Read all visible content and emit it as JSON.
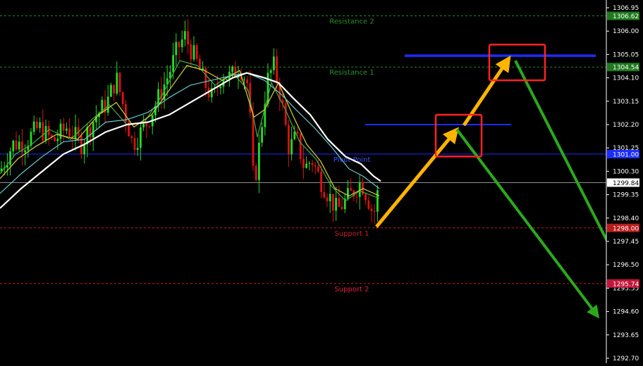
{
  "chart_data": {
    "type": "candlestick",
    "ylim": [
      1292.7,
      1306.95
    ],
    "y_ticks": [
      "1306.95",
      "1306.00",
      "1305.05",
      "1304.10",
      "1303.15",
      "1302.20",
      "1301.25",
      "1300.30",
      "1299.35",
      "1298.40",
      "1297.45",
      "1296.50",
      "1295.55",
      "1294.60",
      "1293.65",
      "1292.70"
    ],
    "current_price": "1299.84",
    "colors": {
      "background": "#000000",
      "bull": "#22dd22",
      "bear": "#dd1111",
      "ma_white": "#ffffff",
      "ma_cyan": "#66cccc",
      "ma_yellow": "#d6d63a",
      "ma_green": "#44aa44",
      "pivot": "#1a2cff",
      "resistance": "#238a23",
      "support": "#c81e1e",
      "arrow_up": "#ffb400",
      "arrow_down": "#2aaa1a",
      "box": "#ff2222"
    },
    "levels": [
      {
        "name": "Resistance 2",
        "value": 1306.62,
        "value_label": "1306.62",
        "style": "dash",
        "color": "#238a23",
        "label_color": "#2a8f2a",
        "tag_bg": "#1f7a1f"
      },
      {
        "name": "Resistance 1",
        "value": 1304.54,
        "value_label": "1304.54",
        "style": "dash",
        "color": "#238a23",
        "label_color": "#2a8f2a",
        "tag_bg": "#1f7a1f"
      },
      {
        "name": "Pivot Point",
        "value": 1301.0,
        "value_label": "1301.00",
        "style": "solid",
        "color": "#1a2cff",
        "label_color": "#3a56ff",
        "tag_bg": "#1a2cff"
      },
      {
        "name": "Support 1",
        "value": 1298.0,
        "value_label": "1298.00",
        "style": "dash",
        "color": "#c81e1e",
        "label_color": "#c81e1e",
        "tag_bg": "#b71c1c"
      },
      {
        "name": "Support 2",
        "value": 1295.74,
        "value_label": "1295.74",
        "style": "dash",
        "color": "#c81e1e",
        "label_color": "#e0203a",
        "tag_bg": "#c2153a"
      }
    ],
    "target_lines": [
      {
        "value": 1302.2,
        "x_from": 518,
        "x_to": 725
      },
      {
        "value": 1305.0,
        "x_from": 574,
        "x_to": 845
      }
    ],
    "projection": {
      "up_path": [
        [
          534,
          1298.05
        ],
        [
          648,
          1302.0
        ],
        [
          722,
          1304.9
        ]
      ],
      "down_1": {
        "from": [
          648,
          1302.0
        ],
        "to": [
          848,
          1294.4
        ]
      },
      "down_2": {
        "from": [
          731,
          1304.8
        ],
        "to": [
          912,
          1294.6
        ]
      },
      "boxes": [
        {
          "x": 618,
          "y0": 1302.6,
          "y1": 1300.9,
          "w": 65
        },
        {
          "x": 694,
          "y0": 1305.45,
          "y1": 1304.0,
          "w": 79
        }
      ]
    },
    "price_path": [
      [
        0,
        1300.3
      ],
      [
        18,
        1301.4
      ],
      [
        36,
        1301.5
      ],
      [
        55,
        1302.1
      ],
      [
        75,
        1301.5
      ],
      [
        95,
        1302.1
      ],
      [
        115,
        1301.4
      ],
      [
        135,
        1302.5
      ],
      [
        152,
        1303.1
      ],
      [
        165,
        1304.1
      ],
      [
        178,
        1302.6
      ],
      [
        188,
        1301.4
      ],
      [
        205,
        1302.1
      ],
      [
        222,
        1303.1
      ],
      [
        240,
        1304.3
      ],
      [
        252,
        1305.3
      ],
      [
        262,
        1305.8
      ],
      [
        278,
        1304.8
      ],
      [
        290,
        1303.9
      ],
      [
        302,
        1303.2
      ],
      [
        315,
        1304.3
      ],
      [
        327,
        1304.1
      ],
      [
        340,
        1304.6
      ],
      [
        352,
        1303.8
      ],
      [
        360,
        1299.6
      ],
      [
        368,
        1301.4
      ],
      [
        378,
        1303.9
      ],
      [
        388,
        1304.6
      ],
      [
        398,
        1303.4
      ],
      [
        410,
        1301.2
      ],
      [
        420,
        1301.7
      ],
      [
        432,
        1300.4
      ],
      [
        442,
        1300.8
      ],
      [
        452,
        1300.1
      ],
      [
        465,
        1299.4
      ],
      [
        478,
        1298.7
      ],
      [
        490,
        1299.1
      ],
      [
        502,
        1299.5
      ],
      [
        512,
        1299.9
      ],
      [
        522,
        1299.2
      ],
      [
        530,
        1298.5
      ],
      [
        538,
        1299.8
      ]
    ],
    "ma_white": [
      [
        0,
        1298.8
      ],
      [
        30,
        1299.6
      ],
      [
        60,
        1300.3
      ],
      [
        90,
        1301.0
      ],
      [
        120,
        1301.4
      ],
      [
        150,
        1301.9
      ],
      [
        180,
        1302.2
      ],
      [
        210,
        1302.3
      ],
      [
        240,
        1302.6
      ],
      [
        270,
        1303.1
      ],
      [
        300,
        1303.6
      ],
      [
        330,
        1304.1
      ],
      [
        350,
        1304.3
      ],
      [
        375,
        1304.1
      ],
      [
        395,
        1303.9
      ],
      [
        415,
        1303.3
      ],
      [
        440,
        1302.6
      ],
      [
        465,
        1301.6
      ],
      [
        490,
        1300.9
      ],
      [
        512,
        1300.6
      ],
      [
        530,
        1300.1
      ],
      [
        540,
        1299.9
      ]
    ],
    "ma_cyan": [
      [
        0,
        1299.4
      ],
      [
        30,
        1300.2
      ],
      [
        60,
        1300.9
      ],
      [
        90,
        1301.5
      ],
      [
        120,
        1301.6
      ],
      [
        150,
        1302.3
      ],
      [
        180,
        1302.4
      ],
      [
        210,
        1302.7
      ],
      [
        240,
        1303.3
      ],
      [
        270,
        1303.8
      ],
      [
        300,
        1304.0
      ],
      [
        330,
        1304.2
      ],
      [
        350,
        1304.3
      ],
      [
        375,
        1304.0
      ],
      [
        400,
        1303.4
      ],
      [
        420,
        1302.8
      ],
      [
        445,
        1302.1
      ],
      [
        470,
        1301.3
      ],
      [
        495,
        1300.4
      ],
      [
        515,
        1300.1
      ],
      [
        538,
        1299.6
      ]
    ],
    "ma_yellow": [
      [
        0,
        1300.0
      ],
      [
        25,
        1300.8
      ],
      [
        50,
        1301.3
      ],
      [
        80,
        1301.8
      ],
      [
        110,
        1301.6
      ],
      [
        140,
        1302.6
      ],
      [
        165,
        1303.1
      ],
      [
        190,
        1302.1
      ],
      [
        215,
        1302.6
      ],
      [
        240,
        1303.6
      ],
      [
        265,
        1304.6
      ],
      [
        290,
        1304.4
      ],
      [
        315,
        1304.0
      ],
      [
        340,
        1304.4
      ],
      [
        360,
        1302.5
      ],
      [
        375,
        1302.8
      ],
      [
        395,
        1303.9
      ],
      [
        415,
        1302.6
      ],
      [
        435,
        1301.4
      ],
      [
        455,
        1300.7
      ],
      [
        475,
        1299.6
      ],
      [
        495,
        1299.3
      ],
      [
        515,
        1299.6
      ],
      [
        538,
        1299.3
      ]
    ],
    "ma_green": [
      [
        0,
        1300.2
      ],
      [
        22,
        1301.0
      ],
      [
        45,
        1301.4
      ],
      [
        70,
        1302.0
      ],
      [
        100,
        1301.6
      ],
      [
        130,
        1302.4
      ],
      [
        155,
        1303.0
      ],
      [
        180,
        1302.2
      ],
      [
        205,
        1302.3
      ],
      [
        230,
        1303.4
      ],
      [
        255,
        1304.8
      ],
      [
        280,
        1304.6
      ],
      [
        305,
        1303.8
      ],
      [
        330,
        1304.3
      ],
      [
        352,
        1303.6
      ],
      [
        365,
        1301.7
      ],
      [
        385,
        1303.9
      ],
      [
        405,
        1302.8
      ],
      [
        425,
        1301.5
      ],
      [
        448,
        1300.8
      ],
      [
        470,
        1299.7
      ],
      [
        490,
        1299.1
      ],
      [
        510,
        1299.5
      ],
      [
        538,
        1299.2
      ]
    ]
  }
}
